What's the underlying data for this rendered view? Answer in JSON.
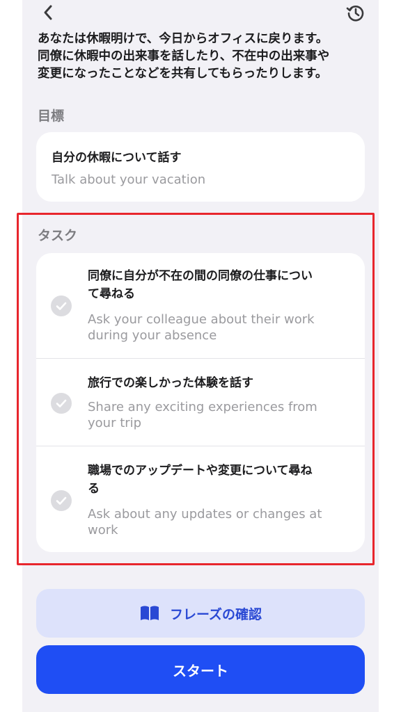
{
  "intro": {
    "text": "あなたは休暇明けで、今日からオフィスに戻ります。\n同僚に休暇中の出来事を話したり、不在中の出来事や\n変更になったことなどを共有してもらったりします。"
  },
  "goal": {
    "section_title": "目標",
    "title_jp": "自分の休暇について話す",
    "title_en": "Talk about your vacation"
  },
  "tasks": {
    "section_title": "タスク",
    "items": [
      {
        "jp": "同僚に自分が不在の間の同僚の仕事につい\nて尋ねる",
        "en": "Ask your colleague about their work\nduring your absence"
      },
      {
        "jp": "旅行での楽しかった体験を話す",
        "en": "Share any exciting experiences from\nyour trip"
      },
      {
        "jp": "職場でのアップデートや変更について尋ね\nる",
        "en": "Ask about any updates or changes at\nwork"
      }
    ]
  },
  "buttons": {
    "phrases_label": "フレーズの確認",
    "start_label": "スタート"
  },
  "icons": {
    "back": "chevron-left-icon",
    "history": "history-icon",
    "check": "checkmark-circle-icon",
    "book": "book-icon"
  },
  "colors": {
    "accent": "#1f4ef4",
    "highlight": "#e8262d",
    "secondary_button_bg": "#dde2fb"
  }
}
